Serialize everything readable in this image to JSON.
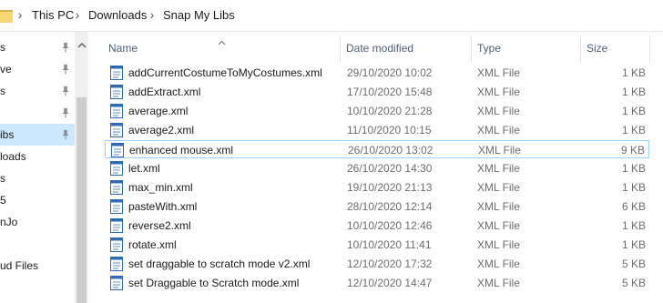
{
  "address": {
    "crumbs": [
      "This PC",
      "Downloads",
      "Snap My Libs"
    ],
    "separator": "›"
  },
  "nav": {
    "items": [
      {
        "label": "s",
        "pinned": true,
        "selected": false
      },
      {
        "label": "ve",
        "pinned": true,
        "selected": false
      },
      {
        "label": "s",
        "pinned": true,
        "selected": false
      },
      {
        "label": "",
        "pinned": true,
        "selected": false
      },
      {
        "label": "ibs",
        "pinned": true,
        "selected": true
      },
      {
        "label": "loads",
        "pinned": false,
        "selected": false
      },
      {
        "label": "s",
        "pinned": false,
        "selected": false
      },
      {
        "label": "5",
        "pinned": false,
        "selected": false
      },
      {
        "label": "nJo",
        "pinned": false,
        "selected": false
      },
      {
        "label": "",
        "pinned": false,
        "selected": false
      },
      {
        "label": "ud Files",
        "pinned": false,
        "selected": false
      }
    ]
  },
  "columns": {
    "name": "Name",
    "date": "Date modified",
    "type": "Type",
    "size": "Size",
    "sorted_by": "name"
  },
  "files": [
    {
      "name": "addCurrentCostumeToMyCostumes.xml",
      "date": "29/10/2020 10:02",
      "type": "XML File",
      "size": "1 KB"
    },
    {
      "name": "addExtract.xml",
      "date": "17/10/2020 15:48",
      "type": "XML File",
      "size": "1 KB"
    },
    {
      "name": "average.xml",
      "date": "10/10/2020 21:28",
      "type": "XML File",
      "size": "1 KB"
    },
    {
      "name": "average2.xml",
      "date": "11/10/2020 10:15",
      "type": "XML File",
      "size": "1 KB"
    },
    {
      "name": "enhanced mouse.xml",
      "date": "26/10/2020 13:02",
      "type": "XML File",
      "size": "9 KB",
      "focused": true
    },
    {
      "name": "let.xml",
      "date": "26/10/2020 14:30",
      "type": "XML File",
      "size": "1 KB"
    },
    {
      "name": "max_min.xml",
      "date": "19/10/2020 21:13",
      "type": "XML File",
      "size": "1 KB"
    },
    {
      "name": "pasteWith.xml",
      "date": "28/10/2020 12:14",
      "type": "XML File",
      "size": "6 KB"
    },
    {
      "name": "reverse2.xml",
      "date": "10/10/2020 12:46",
      "type": "XML File",
      "size": "1 KB"
    },
    {
      "name": "rotate.xml",
      "date": "10/10/2020 11:41",
      "type": "XML File",
      "size": "1 KB"
    },
    {
      "name": "set draggable to scratch mode v2.xml",
      "date": "12/10/2020 17:32",
      "type": "XML File",
      "size": "5 KB"
    },
    {
      "name": "set Draggable to Scratch mode.xml",
      "date": "12/10/2020 14:47",
      "type": "XML File",
      "size": "5 KB"
    }
  ],
  "colors": {
    "selection": "#cce8ff",
    "focus_border": "#99d1ff",
    "header_text": "#4c607a",
    "folder": "#f8d775"
  },
  "icons": {
    "folder": "folder-icon",
    "pin": "pin-icon",
    "file": "xml-file-icon",
    "sort": "sort-up-arrow-icon",
    "scroll_up": "chevron-up-icon"
  }
}
